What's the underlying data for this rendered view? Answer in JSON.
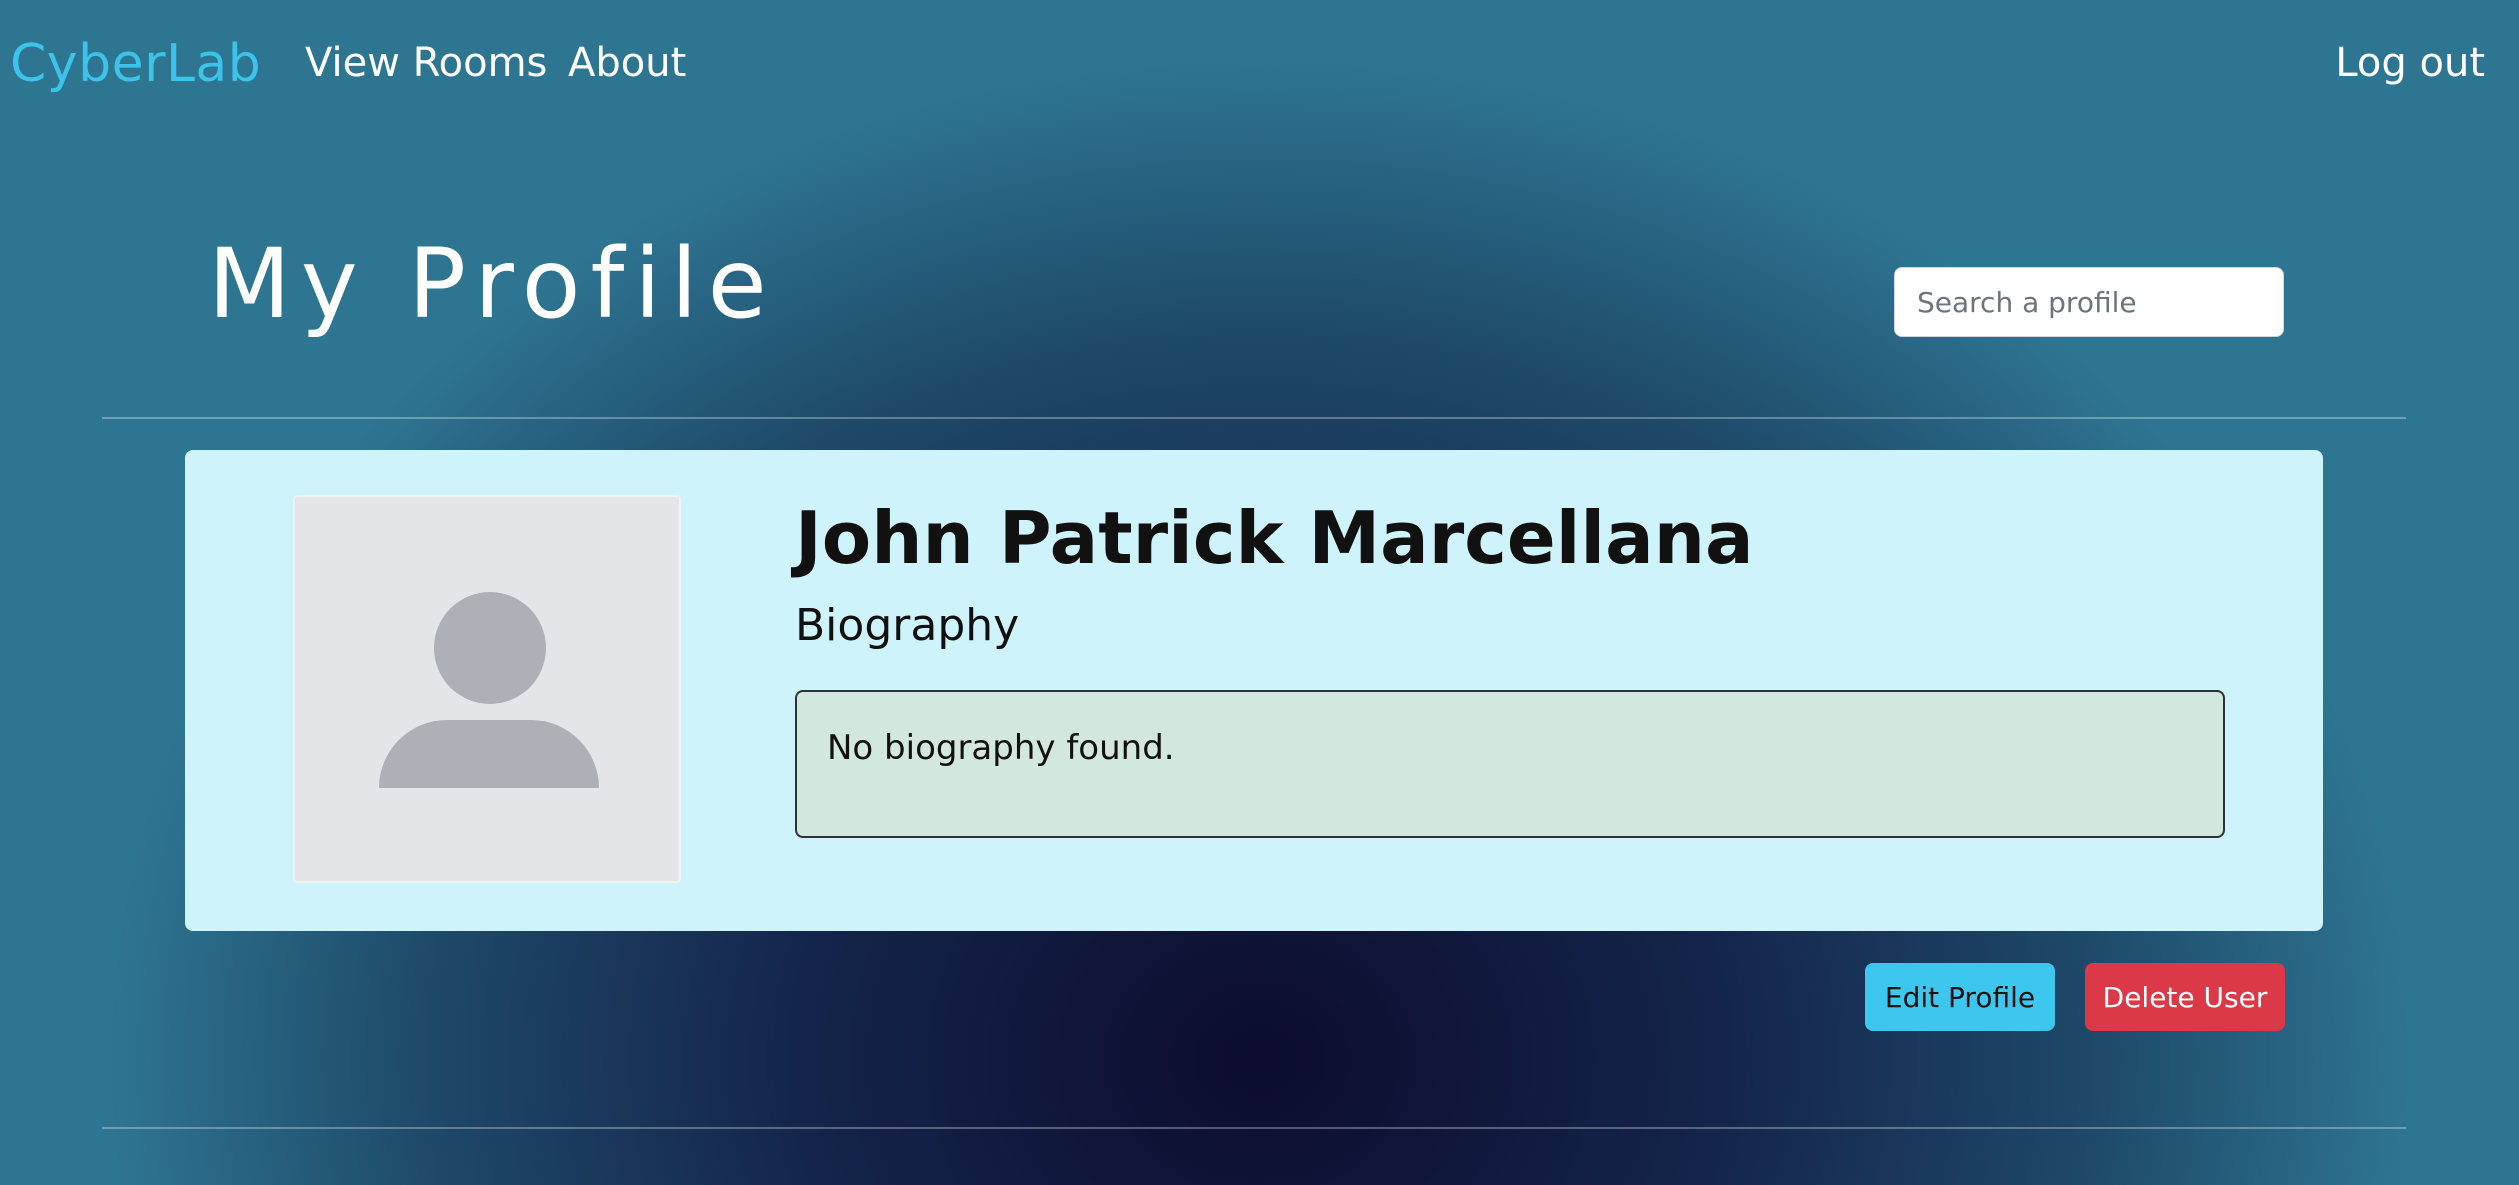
{
  "navbar": {
    "brand": "CyberLab",
    "links": [
      {
        "label": "View Rooms"
      },
      {
        "label": "About"
      }
    ],
    "logout_label": "Log out"
  },
  "header": {
    "title": "My Profile",
    "search_placeholder": "Search a profile"
  },
  "profile": {
    "name": "John Patrick Marcellana",
    "biography_heading": "Biography",
    "biography_text": "No biography found."
  },
  "actions": {
    "edit_label": "Edit Profile",
    "delete_label": "Delete User"
  },
  "colors": {
    "brand": "#3cc3ea",
    "card_background": "#cff3fb",
    "bio_background": "#d2e7de",
    "edit_button": "#3ec7ee",
    "delete_button": "#db3848"
  },
  "icons": {
    "avatar": "user-placeholder-icon"
  }
}
